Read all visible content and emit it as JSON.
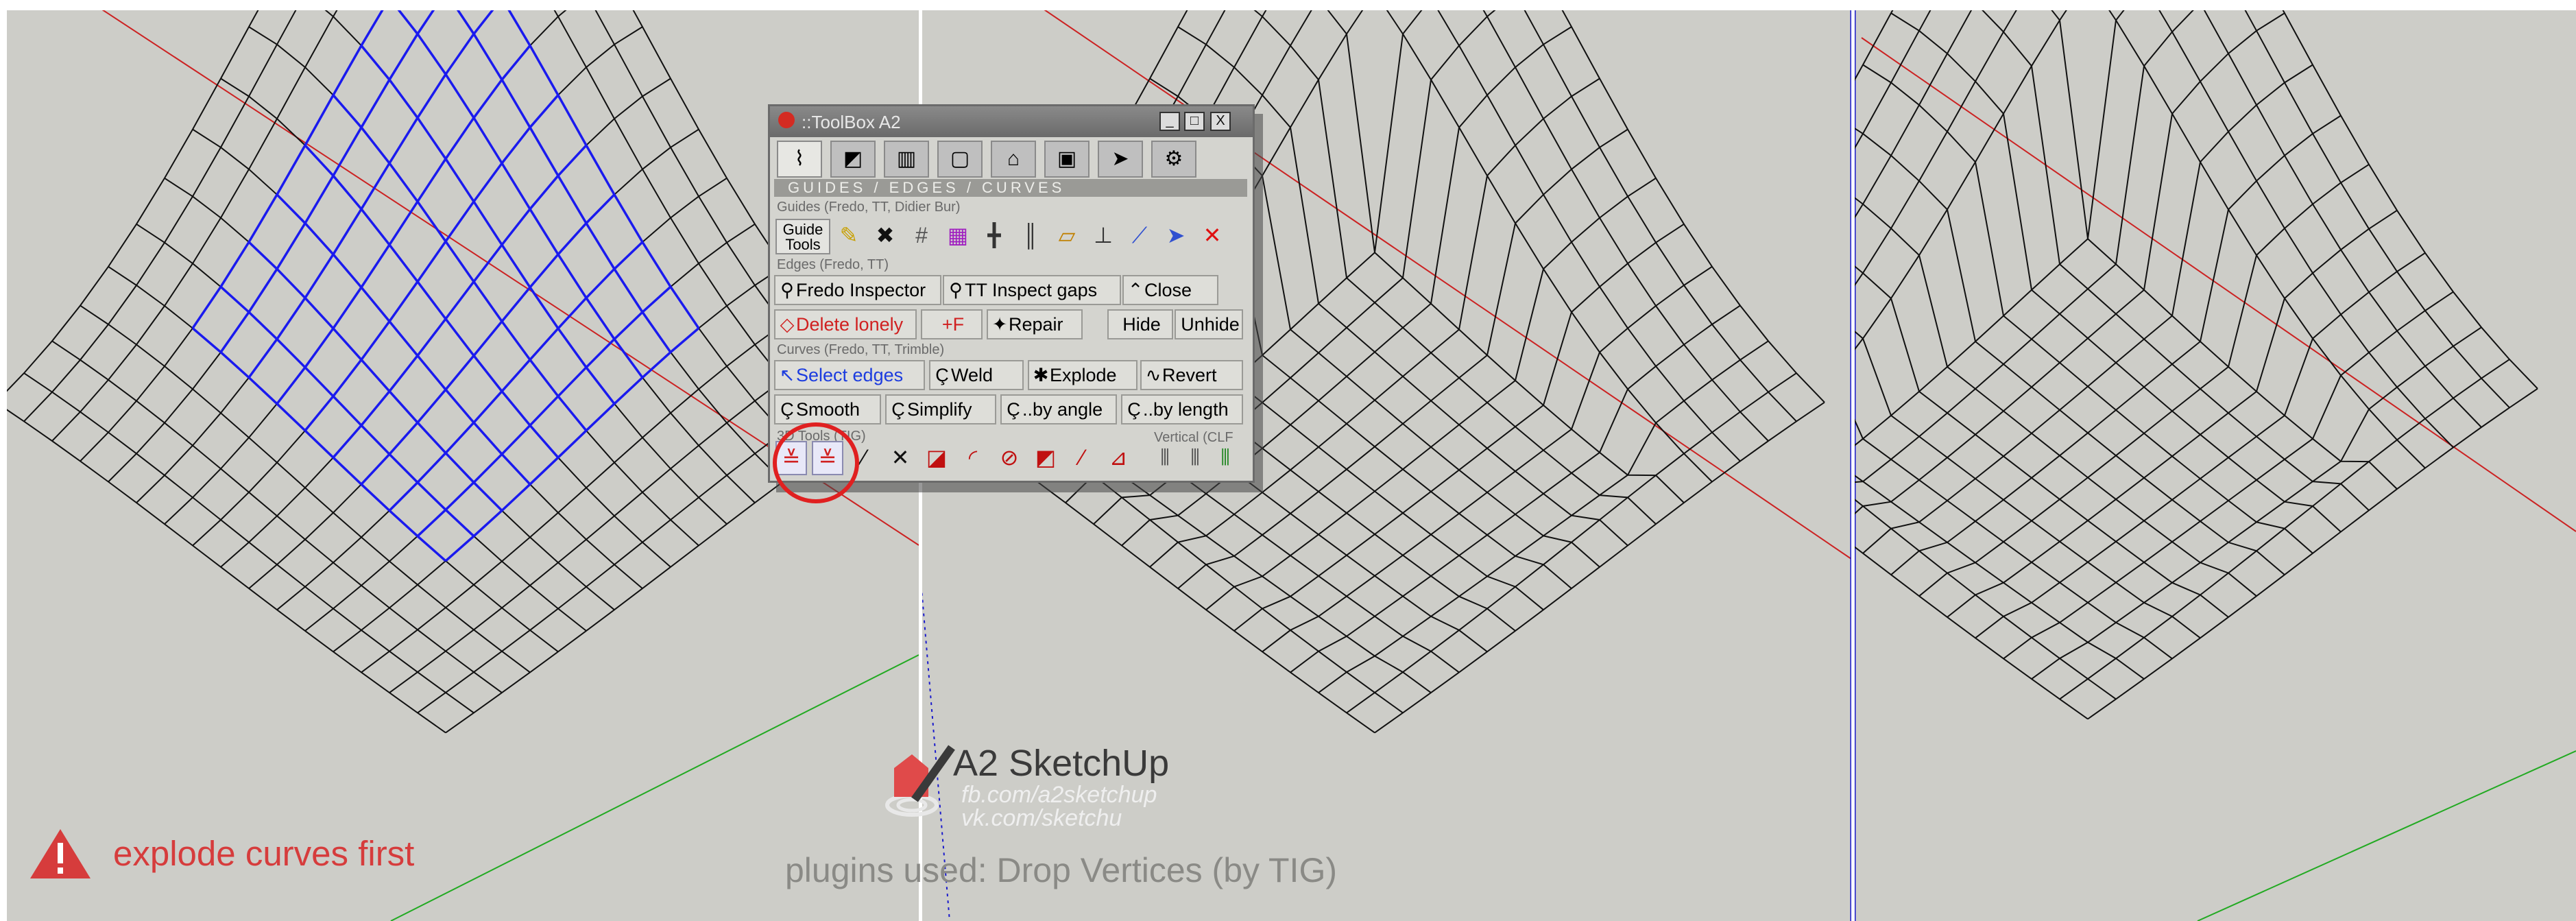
{
  "viewports": [
    {
      "name": "grid-blue-selected"
    },
    {
      "name": "grid-dropped"
    },
    {
      "name": "grid-dropped-right"
    }
  ],
  "toolbox": {
    "title": "::ToolBox A2",
    "win_buttons": [
      "_",
      "□",
      "X"
    ],
    "tab_icons": [
      "guides-edges-icon",
      "blue-cube-icon",
      "book-icon",
      "layers-icon",
      "house-icon",
      "image-icon",
      "cursor-icon",
      "settings-icon"
    ],
    "section_header": "GUIDES / EDGES / CURVES",
    "guides_group": "Guides (Fredo, TT, Didier Bur)",
    "guide_tools_label": "Guide Tools",
    "edges_group": "Edges (Fredo, TT)",
    "edges_row1": [
      "Fredo Inspector",
      "TT Inspect gaps",
      "Close"
    ],
    "edges_row2": [
      "Delete lonely",
      "+F",
      "Repair",
      "Hide",
      "Unhide"
    ],
    "curves_group": "Curves (Fredo, TT, Trimble)",
    "curves_row1": [
      "Select edges",
      "Weld",
      "Explode",
      "Revert"
    ],
    "curves_row2": [
      "Smooth",
      "Simplify",
      "..by angle",
      "..by length"
    ],
    "tools_group": "3D Tools (TIG)",
    "vertical_group": "Vertical (CLF"
  },
  "warning": {
    "text": "explode curves first",
    "icon": "warning-triangle-icon",
    "color": "#d63c3c"
  },
  "brand": {
    "name": "A2 SketchUp",
    "fb": "fb.com/a2sketchup",
    "vk": "vk.com/sketchu"
  },
  "plugins_text": "plugins used: Drop Vertices (by TIG)",
  "colors": {
    "background": "#cdcdc8",
    "red_axis": "#cc2222",
    "blue_axis": "#1a1acc",
    "green_axis": "#22aa22",
    "selection": "#1a1aee"
  }
}
